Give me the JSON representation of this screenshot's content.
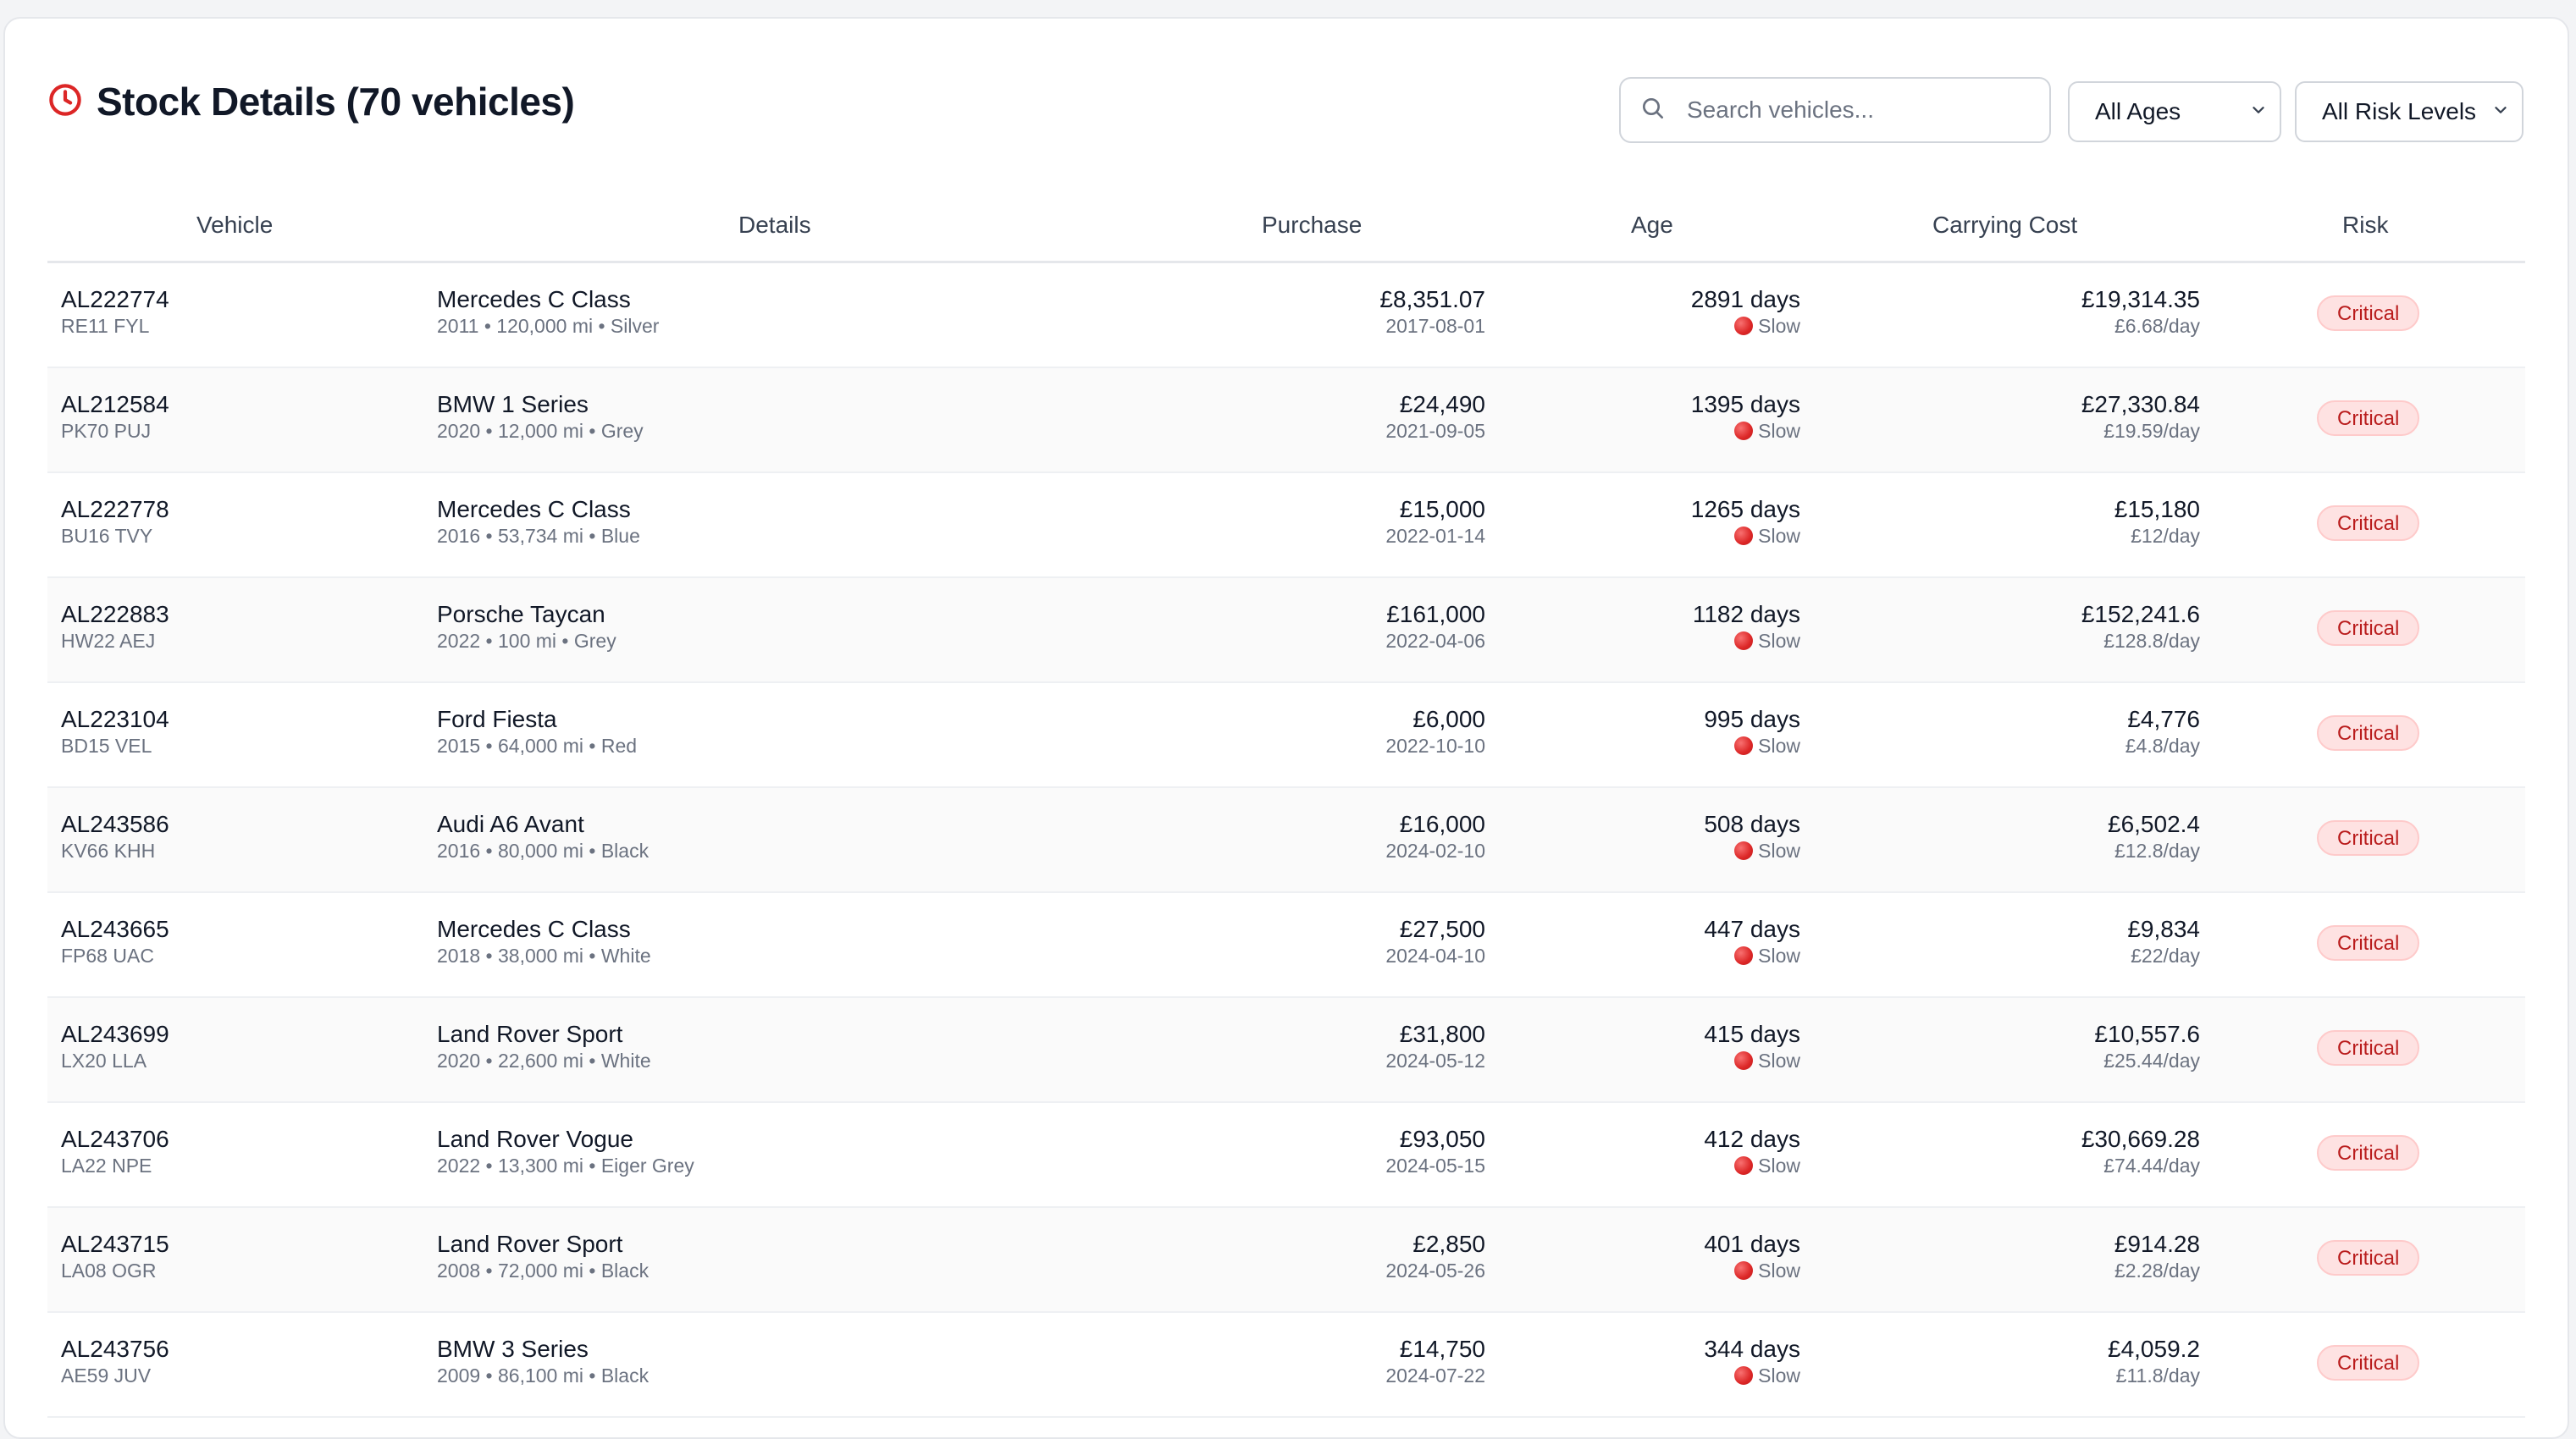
{
  "header": {
    "title": "Stock Details (70 vehicles)",
    "accent_color": "#dc2626",
    "search_placeholder": "Search vehicles...",
    "age_filter": "All Ages",
    "risk_filter": "All Risk Levels"
  },
  "table": {
    "columns": [
      "Vehicle",
      "Details",
      "Purchase",
      "Age",
      "Carrying Cost",
      "Risk"
    ],
    "rows": [
      {
        "id": "AL222774",
        "reg": "RE11 FYL",
        "model": "Mercedes C Class",
        "details": "2011 • 120,000 mi • Silver",
        "purchase": "£8,351.07",
        "purchase_date": "2017-08-01",
        "age": "2891 days",
        "status": "Slow",
        "cost": "£19,314.35",
        "cost_per_day": "£6.68/day",
        "risk": "Critical"
      },
      {
        "id": "AL212584",
        "reg": "PK70 PUJ",
        "model": "BMW 1 Series",
        "details": "2020 • 12,000 mi • Grey",
        "purchase": "£24,490",
        "purchase_date": "2021-09-05",
        "age": "1395 days",
        "status": "Slow",
        "cost": "£27,330.84",
        "cost_per_day": "£19.59/day",
        "risk": "Critical"
      },
      {
        "id": "AL222778",
        "reg": "BU16 TVY",
        "model": "Mercedes C Class",
        "details": "2016 • 53,734 mi • Blue",
        "purchase": "£15,000",
        "purchase_date": "2022-01-14",
        "age": "1265 days",
        "status": "Slow",
        "cost": "£15,180",
        "cost_per_day": "£12/day",
        "risk": "Critical"
      },
      {
        "id": "AL222883",
        "reg": "HW22 AEJ",
        "model": "Porsche Taycan",
        "details": "2022 • 100 mi • Grey",
        "purchase": "£161,000",
        "purchase_date": "2022-04-06",
        "age": "1182 days",
        "status": "Slow",
        "cost": "£152,241.6",
        "cost_per_day": "£128.8/day",
        "risk": "Critical"
      },
      {
        "id": "AL223104",
        "reg": "BD15 VEL",
        "model": "Ford Fiesta",
        "details": "2015 • 64,000 mi • Red",
        "purchase": "£6,000",
        "purchase_date": "2022-10-10",
        "age": "995 days",
        "status": "Slow",
        "cost": "£4,776",
        "cost_per_day": "£4.8/day",
        "risk": "Critical"
      },
      {
        "id": "AL243586",
        "reg": "KV66 KHH",
        "model": "Audi A6 Avant",
        "details": "2016 • 80,000 mi • Black",
        "purchase": "£16,000",
        "purchase_date": "2024-02-10",
        "age": "508 days",
        "status": "Slow",
        "cost": "£6,502.4",
        "cost_per_day": "£12.8/day",
        "risk": "Critical"
      },
      {
        "id": "AL243665",
        "reg": "FP68 UAC",
        "model": "Mercedes C Class",
        "details": "2018 • 38,000 mi • White",
        "purchase": "£27,500",
        "purchase_date": "2024-04-10",
        "age": "447 days",
        "status": "Slow",
        "cost": "£9,834",
        "cost_per_day": "£22/day",
        "risk": "Critical"
      },
      {
        "id": "AL243699",
        "reg": "LX20 LLA",
        "model": "Land Rover Sport",
        "details": "2020 • 22,600 mi • White",
        "purchase": "£31,800",
        "purchase_date": "2024-05-12",
        "age": "415 days",
        "status": "Slow",
        "cost": "£10,557.6",
        "cost_per_day": "£25.44/day",
        "risk": "Critical"
      },
      {
        "id": "AL243706",
        "reg": "LA22 NPE",
        "model": "Land Rover Vogue",
        "details": "2022 • 13,300 mi • Eiger Grey",
        "purchase": "£93,050",
        "purchase_date": "2024-05-15",
        "age": "412 days",
        "status": "Slow",
        "cost": "£30,669.28",
        "cost_per_day": "£74.44/day",
        "risk": "Critical"
      },
      {
        "id": "AL243715",
        "reg": "LA08 OGR",
        "model": "Land Rover Sport",
        "details": "2008 • 72,000 mi • Black",
        "purchase": "£2,850",
        "purchase_date": "2024-05-26",
        "age": "401 days",
        "status": "Slow",
        "cost": "£914.28",
        "cost_per_day": "£2.28/day",
        "risk": "Critical"
      },
      {
        "id": "AL243756",
        "reg": "AE59 JUV",
        "model": "BMW 3 Series",
        "details": "2009 • 86,100 mi • Black",
        "purchase": "£14,750",
        "purchase_date": "2024-07-22",
        "age": "344 days",
        "status": "Slow",
        "cost": "£4,059.2",
        "cost_per_day": "£11.8/day",
        "risk": "Critical"
      }
    ]
  }
}
